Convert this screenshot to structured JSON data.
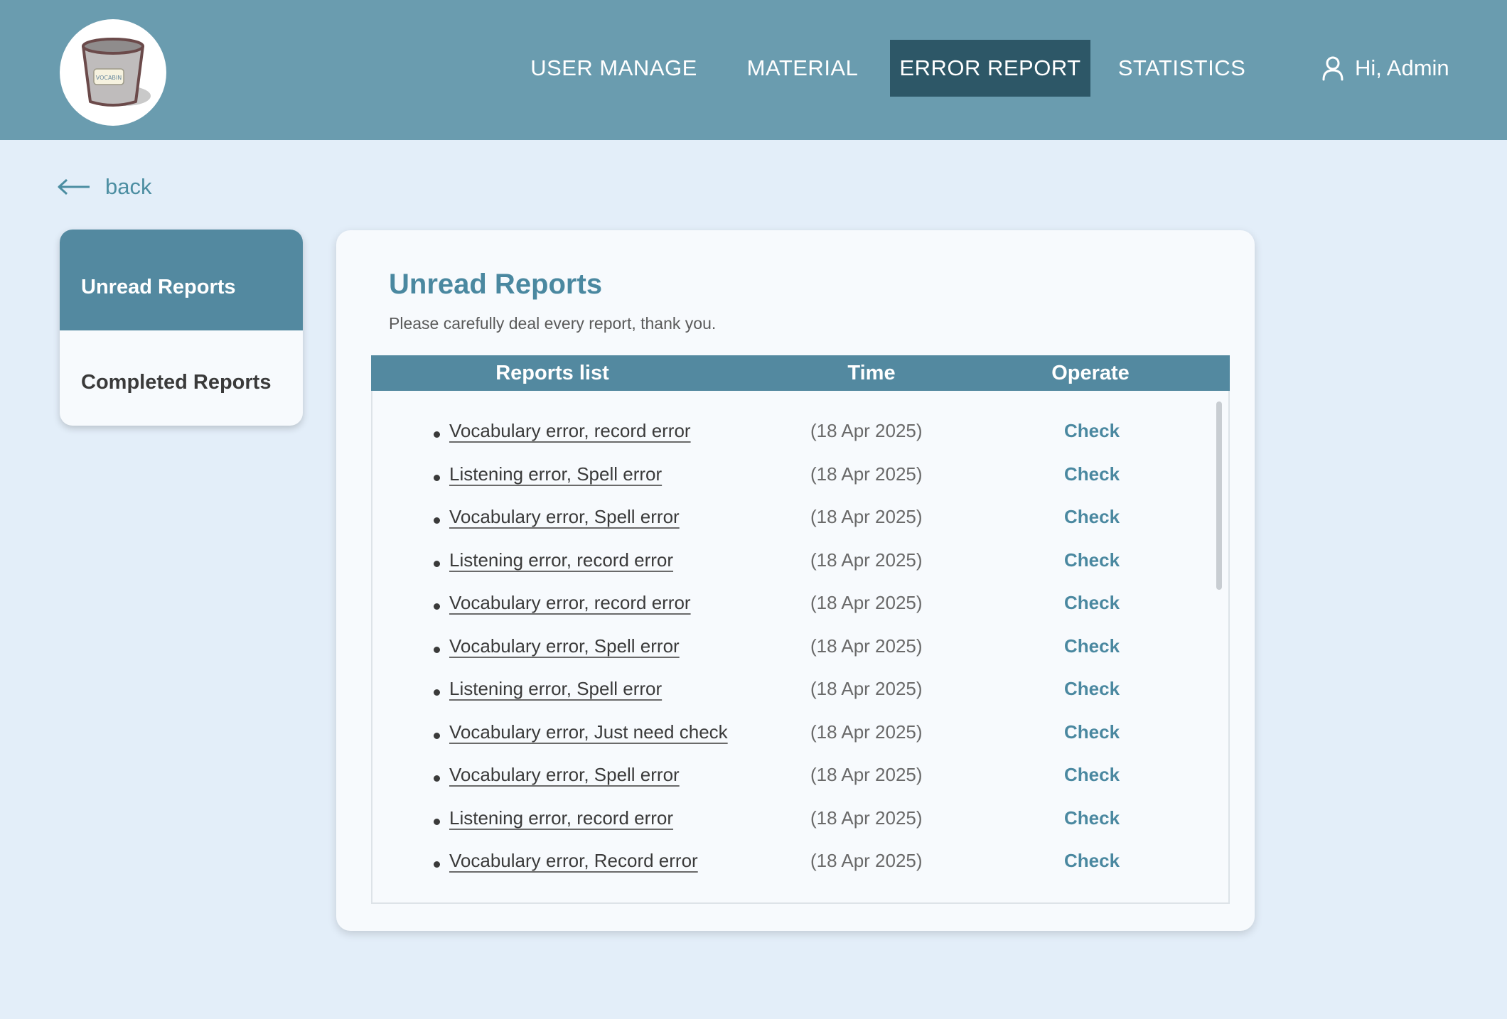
{
  "logo": {
    "text": "VOCABIN"
  },
  "nav": {
    "items": [
      "USER MANAGE",
      "MATERIAL",
      "ERROR REPORT",
      "STATISTICS"
    ],
    "active": "ERROR REPORT"
  },
  "user": {
    "greeting": "Hi, Admin"
  },
  "back": {
    "label": "back"
  },
  "sidebar": {
    "items": [
      "Unread Reports",
      "Completed Reports"
    ],
    "active": "Unread Reports"
  },
  "card": {
    "title": "Unread Reports",
    "subtitle": "Please carefully deal every report, thank you."
  },
  "table": {
    "headers": [
      "Reports list",
      "Time",
      "Operate"
    ],
    "rows": [
      {
        "title": "Vocabulary error, record error",
        "time": "(18 Apr 2025)",
        "action": "Check"
      },
      {
        "title": "Listening error, Spell error",
        "time": "(18 Apr 2025)",
        "action": "Check"
      },
      {
        "title": "Vocabulary error, Spell error",
        "time": "(18 Apr 2025)",
        "action": "Check"
      },
      {
        "title": "Listening error, record error",
        "time": "(18 Apr 2025)",
        "action": "Check"
      },
      {
        "title": "Vocabulary error, record error",
        "time": "(18 Apr 2025)",
        "action": "Check"
      },
      {
        "title": "Vocabulary error, Spell error",
        "time": "(18 Apr 2025)",
        "action": "Check"
      },
      {
        "title": "Listening error, Spell error",
        "time": "(18 Apr 2025)",
        "action": "Check"
      },
      {
        "title": "Vocabulary error, Just need check",
        "time": "(18 Apr 2025)",
        "action": "Check"
      },
      {
        "title": "Vocabulary error, Spell error",
        "time": "(18 Apr 2025)",
        "action": "Check"
      },
      {
        "title": "Listening error, record error",
        "time": "(18 Apr 2025)",
        "action": "Check"
      },
      {
        "title": "Vocabulary error, Record error",
        "time": "(18 Apr 2025)",
        "action": "Check"
      }
    ]
  },
  "colors": {
    "header": "#6a9caf",
    "nav_active": "#2d5767",
    "accent": "#4a88a0",
    "table_header": "#5389a0",
    "page_background": "#e3eef9"
  },
  "icons": [
    "bucket-logo-icon",
    "user-icon",
    "back-arrow-icon"
  ]
}
